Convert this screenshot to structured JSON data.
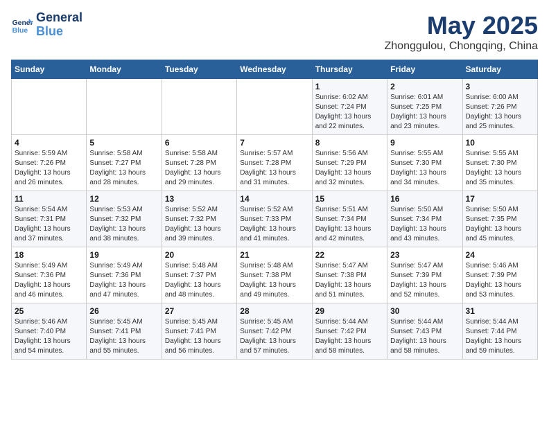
{
  "header": {
    "logo_line1": "General",
    "logo_line2": "Blue",
    "month": "May 2025",
    "location": "Zhonggulou, Chongqing, China"
  },
  "weekdays": [
    "Sunday",
    "Monday",
    "Tuesday",
    "Wednesday",
    "Thursday",
    "Friday",
    "Saturday"
  ],
  "weeks": [
    [
      {
        "day": "",
        "info": ""
      },
      {
        "day": "",
        "info": ""
      },
      {
        "day": "",
        "info": ""
      },
      {
        "day": "",
        "info": ""
      },
      {
        "day": "1",
        "info": "Sunrise: 6:02 AM\nSunset: 7:24 PM\nDaylight: 13 hours and 22 minutes."
      },
      {
        "day": "2",
        "info": "Sunrise: 6:01 AM\nSunset: 7:25 PM\nDaylight: 13 hours and 23 minutes."
      },
      {
        "day": "3",
        "info": "Sunrise: 6:00 AM\nSunset: 7:26 PM\nDaylight: 13 hours and 25 minutes."
      }
    ],
    [
      {
        "day": "4",
        "info": "Sunrise: 5:59 AM\nSunset: 7:26 PM\nDaylight: 13 hours and 26 minutes."
      },
      {
        "day": "5",
        "info": "Sunrise: 5:58 AM\nSunset: 7:27 PM\nDaylight: 13 hours and 28 minutes."
      },
      {
        "day": "6",
        "info": "Sunrise: 5:58 AM\nSunset: 7:28 PM\nDaylight: 13 hours and 29 minutes."
      },
      {
        "day": "7",
        "info": "Sunrise: 5:57 AM\nSunset: 7:28 PM\nDaylight: 13 hours and 31 minutes."
      },
      {
        "day": "8",
        "info": "Sunrise: 5:56 AM\nSunset: 7:29 PM\nDaylight: 13 hours and 32 minutes."
      },
      {
        "day": "9",
        "info": "Sunrise: 5:55 AM\nSunset: 7:30 PM\nDaylight: 13 hours and 34 minutes."
      },
      {
        "day": "10",
        "info": "Sunrise: 5:55 AM\nSunset: 7:30 PM\nDaylight: 13 hours and 35 minutes."
      }
    ],
    [
      {
        "day": "11",
        "info": "Sunrise: 5:54 AM\nSunset: 7:31 PM\nDaylight: 13 hours and 37 minutes."
      },
      {
        "day": "12",
        "info": "Sunrise: 5:53 AM\nSunset: 7:32 PM\nDaylight: 13 hours and 38 minutes."
      },
      {
        "day": "13",
        "info": "Sunrise: 5:52 AM\nSunset: 7:32 PM\nDaylight: 13 hours and 39 minutes."
      },
      {
        "day": "14",
        "info": "Sunrise: 5:52 AM\nSunset: 7:33 PM\nDaylight: 13 hours and 41 minutes."
      },
      {
        "day": "15",
        "info": "Sunrise: 5:51 AM\nSunset: 7:34 PM\nDaylight: 13 hours and 42 minutes."
      },
      {
        "day": "16",
        "info": "Sunrise: 5:50 AM\nSunset: 7:34 PM\nDaylight: 13 hours and 43 minutes."
      },
      {
        "day": "17",
        "info": "Sunrise: 5:50 AM\nSunset: 7:35 PM\nDaylight: 13 hours and 45 minutes."
      }
    ],
    [
      {
        "day": "18",
        "info": "Sunrise: 5:49 AM\nSunset: 7:36 PM\nDaylight: 13 hours and 46 minutes."
      },
      {
        "day": "19",
        "info": "Sunrise: 5:49 AM\nSunset: 7:36 PM\nDaylight: 13 hours and 47 minutes."
      },
      {
        "day": "20",
        "info": "Sunrise: 5:48 AM\nSunset: 7:37 PM\nDaylight: 13 hours and 48 minutes."
      },
      {
        "day": "21",
        "info": "Sunrise: 5:48 AM\nSunset: 7:38 PM\nDaylight: 13 hours and 49 minutes."
      },
      {
        "day": "22",
        "info": "Sunrise: 5:47 AM\nSunset: 7:38 PM\nDaylight: 13 hours and 51 minutes."
      },
      {
        "day": "23",
        "info": "Sunrise: 5:47 AM\nSunset: 7:39 PM\nDaylight: 13 hours and 52 minutes."
      },
      {
        "day": "24",
        "info": "Sunrise: 5:46 AM\nSunset: 7:39 PM\nDaylight: 13 hours and 53 minutes."
      }
    ],
    [
      {
        "day": "25",
        "info": "Sunrise: 5:46 AM\nSunset: 7:40 PM\nDaylight: 13 hours and 54 minutes."
      },
      {
        "day": "26",
        "info": "Sunrise: 5:45 AM\nSunset: 7:41 PM\nDaylight: 13 hours and 55 minutes."
      },
      {
        "day": "27",
        "info": "Sunrise: 5:45 AM\nSunset: 7:41 PM\nDaylight: 13 hours and 56 minutes."
      },
      {
        "day": "28",
        "info": "Sunrise: 5:45 AM\nSunset: 7:42 PM\nDaylight: 13 hours and 57 minutes."
      },
      {
        "day": "29",
        "info": "Sunrise: 5:44 AM\nSunset: 7:42 PM\nDaylight: 13 hours and 58 minutes."
      },
      {
        "day": "30",
        "info": "Sunrise: 5:44 AM\nSunset: 7:43 PM\nDaylight: 13 hours and 58 minutes."
      },
      {
        "day": "31",
        "info": "Sunrise: 5:44 AM\nSunset: 7:44 PM\nDaylight: 13 hours and 59 minutes."
      }
    ]
  ]
}
